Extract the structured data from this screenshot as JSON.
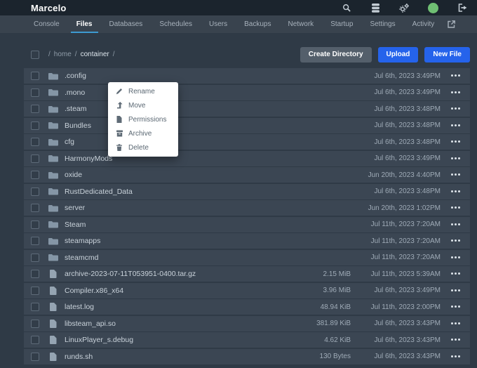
{
  "header": {
    "title": "Marcelo",
    "icons": [
      "search-icon",
      "database-icon",
      "cogs-icon",
      "avatar",
      "logout-icon"
    ]
  },
  "nav": {
    "tabs": [
      {
        "label": "Console",
        "active": false
      },
      {
        "label": "Files",
        "active": true
      },
      {
        "label": "Databases",
        "active": false
      },
      {
        "label": "Schedules",
        "active": false
      },
      {
        "label": "Users",
        "active": false
      },
      {
        "label": "Backups",
        "active": false
      },
      {
        "label": "Network",
        "active": false
      },
      {
        "label": "Startup",
        "active": false
      },
      {
        "label": "Settings",
        "active": false
      },
      {
        "label": "Activity",
        "active": false
      }
    ],
    "external_link_icon": "external-link-icon"
  },
  "toolbar": {
    "breadcrumb": {
      "separator": "/",
      "items": [
        {
          "label": "home",
          "current": false
        },
        {
          "label": "container",
          "current": true
        }
      ]
    },
    "buttons": [
      {
        "label": "Create Directory",
        "style": "gray"
      },
      {
        "label": "Upload",
        "style": "blue"
      },
      {
        "label": "New File",
        "style": "blue"
      }
    ]
  },
  "context_menu": {
    "items": [
      {
        "label": "Rename",
        "icon": "pencil-icon"
      },
      {
        "label": "Move",
        "icon": "level-up-icon"
      },
      {
        "label": "Permissions",
        "icon": "file-icon"
      },
      {
        "label": "Archive",
        "icon": "archive-icon"
      },
      {
        "label": "Delete",
        "icon": "trash-icon"
      }
    ]
  },
  "file_list": {
    "rows": [
      {
        "name": ".config",
        "type": "folder",
        "size": "",
        "modified": "Jul 6th, 2023 3:49PM"
      },
      {
        "name": ".mono",
        "type": "folder",
        "size": "",
        "modified": "Jul 6th, 2023 3:49PM"
      },
      {
        "name": ".steam",
        "type": "folder",
        "size": "",
        "modified": "Jul 6th, 2023 3:48PM"
      },
      {
        "name": "Bundles",
        "type": "folder",
        "size": "",
        "modified": "Jul 6th, 2023 3:48PM"
      },
      {
        "name": "cfg",
        "type": "folder",
        "size": "",
        "modified": "Jul 6th, 2023 3:48PM"
      },
      {
        "name": "HarmonyMods",
        "type": "folder",
        "size": "",
        "modified": "Jul 6th, 2023 3:49PM"
      },
      {
        "name": "oxide",
        "type": "folder",
        "size": "",
        "modified": "Jun 20th, 2023 4:40PM"
      },
      {
        "name": "RustDedicated_Data",
        "type": "folder",
        "size": "",
        "modified": "Jul 6th, 2023 3:48PM"
      },
      {
        "name": "server",
        "type": "folder",
        "size": "",
        "modified": "Jun 20th, 2023 1:02PM"
      },
      {
        "name": "Steam",
        "type": "folder",
        "size": "",
        "modified": "Jul 11th, 2023 7:20AM"
      },
      {
        "name": "steamapps",
        "type": "folder",
        "size": "",
        "modified": "Jul 11th, 2023 7:20AM"
      },
      {
        "name": "steamcmd",
        "type": "folder",
        "size": "",
        "modified": "Jul 11th, 2023 7:20AM"
      },
      {
        "name": "archive-2023-07-11T053951-0400.tar.gz",
        "type": "file",
        "size": "2.15 MiB",
        "modified": "Jul 11th, 2023 5:39AM"
      },
      {
        "name": "Compiler.x86_x64",
        "type": "file",
        "size": "3.96 MiB",
        "modified": "Jul 6th, 2023 3:49PM"
      },
      {
        "name": "latest.log",
        "type": "file",
        "size": "48.94 KiB",
        "modified": "Jul 11th, 2023 2:00PM"
      },
      {
        "name": "libsteam_api.so",
        "type": "file",
        "size": "381.89 KiB",
        "modified": "Jul 6th, 2023 3:43PM"
      },
      {
        "name": "LinuxPlayer_s.debug",
        "type": "file",
        "size": "4.62 KiB",
        "modified": "Jul 6th, 2023 3:43PM"
      },
      {
        "name": "runds.sh",
        "type": "file",
        "size": "130 Bytes",
        "modified": "Jul 6th, 2023 3:43PM"
      }
    ]
  },
  "colors": {
    "topbar_bg": "#1b242d",
    "navbar_bg": "#39434e",
    "page_bg": "#2f3a46",
    "row_bg": "#3b4653",
    "accent_blue": "#2563eb",
    "tab_underline": "#3d9ad1",
    "avatar_green": "#6fbf73"
  }
}
